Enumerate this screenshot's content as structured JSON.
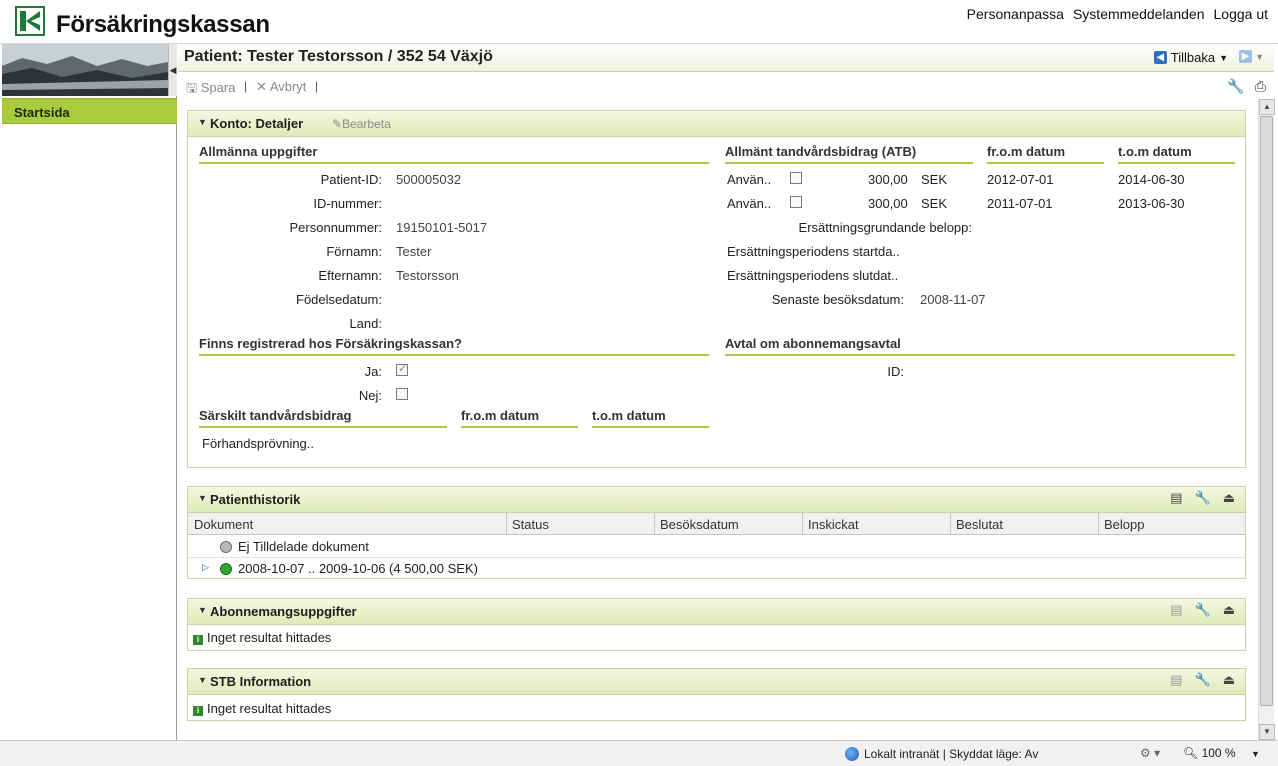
{
  "header": {
    "logo_text": "Försäkringskassan",
    "links": [
      "Personanpassa",
      "Systemmeddelanden",
      "Logga ut"
    ]
  },
  "sidebar": {
    "items": [
      {
        "label": "Startsida"
      }
    ]
  },
  "titlebar": {
    "title": "Patient: Tester Testorsson / 352 54 Växjö",
    "back_label": "Tillbaka"
  },
  "toolbar": {
    "save_label": "Spara",
    "cancel_label": "Avbryt"
  },
  "konto": {
    "title": "Konto: Detaljer",
    "edit_label": "Bearbeta",
    "general": {
      "heading": "Allmänna uppgifter",
      "fields": [
        {
          "label": "Patient-ID:",
          "value": "500005032"
        },
        {
          "label": "ID-nummer:",
          "value": ""
        },
        {
          "label": "Personnummer:",
          "value": "19150101-5017"
        },
        {
          "label": "Förnamn:",
          "value": "Tester"
        },
        {
          "label": "Efternamn:",
          "value": "Testorsson"
        },
        {
          "label": "Födelsedatum:",
          "value": ""
        },
        {
          "label": "Land:",
          "value": ""
        }
      ]
    },
    "registered": {
      "heading": "Finns registrerad hos Försäkringskassan?",
      "yes_label": "Ja:",
      "yes_checked": true,
      "no_label": "Nej:",
      "no_checked": false
    },
    "stb": {
      "heading": "Särskilt tandvårdsbidrag",
      "from_heading": "fr.o.m datum",
      "to_heading": "t.o.m datum",
      "row_label": "Förhandsprövning.."
    },
    "atb": {
      "heading": "Allmänt tandvårdsbidrag (ATB)",
      "from_heading": "fr.o.m datum",
      "to_heading": "t.o.m datum",
      "rows": [
        {
          "label": "Använ..",
          "amount": "300,00",
          "currency": "SEK",
          "from": "2012-07-01",
          "to": "2014-06-30"
        },
        {
          "label": "Använ..",
          "amount": "300,00",
          "currency": "SEK",
          "from": "2011-07-01",
          "to": "2013-06-30"
        }
      ],
      "compensation_basis_label": "Ersättningsgrundande belopp:",
      "period_start_label": "Ersättningsperiodens startda..",
      "period_end_label": "Ersättningsperiodens slutdat..",
      "last_visit_label": "Senaste besöksdatum:",
      "last_visit_value": "2008-11-07"
    },
    "subscription": {
      "heading": "Avtal om abonnemangsavtal",
      "id_label": "ID:"
    }
  },
  "history": {
    "title": "Patienthistorik",
    "columns": [
      "Dokument",
      "Status",
      "Besöksdatum",
      "Inskickat",
      "Beslutat",
      "Belopp"
    ],
    "rows": [
      {
        "label": "Ej Tilldelade dokument",
        "status_color": "#b8b8b8"
      },
      {
        "label": "2008-10-07 .. 2009-10-06 (4 500,00 SEK)",
        "status_color": "#2fa52f"
      }
    ]
  },
  "subscription_panel": {
    "title": "Abonnemangsuppgifter",
    "message": "Inget resultat hittades"
  },
  "stb_panel": {
    "title": "STB Information",
    "message": "Inget resultat hittades"
  },
  "statusbar": {
    "zone": "Lokalt intranät | Skyddat läge: Av",
    "zoom": "100 %"
  }
}
